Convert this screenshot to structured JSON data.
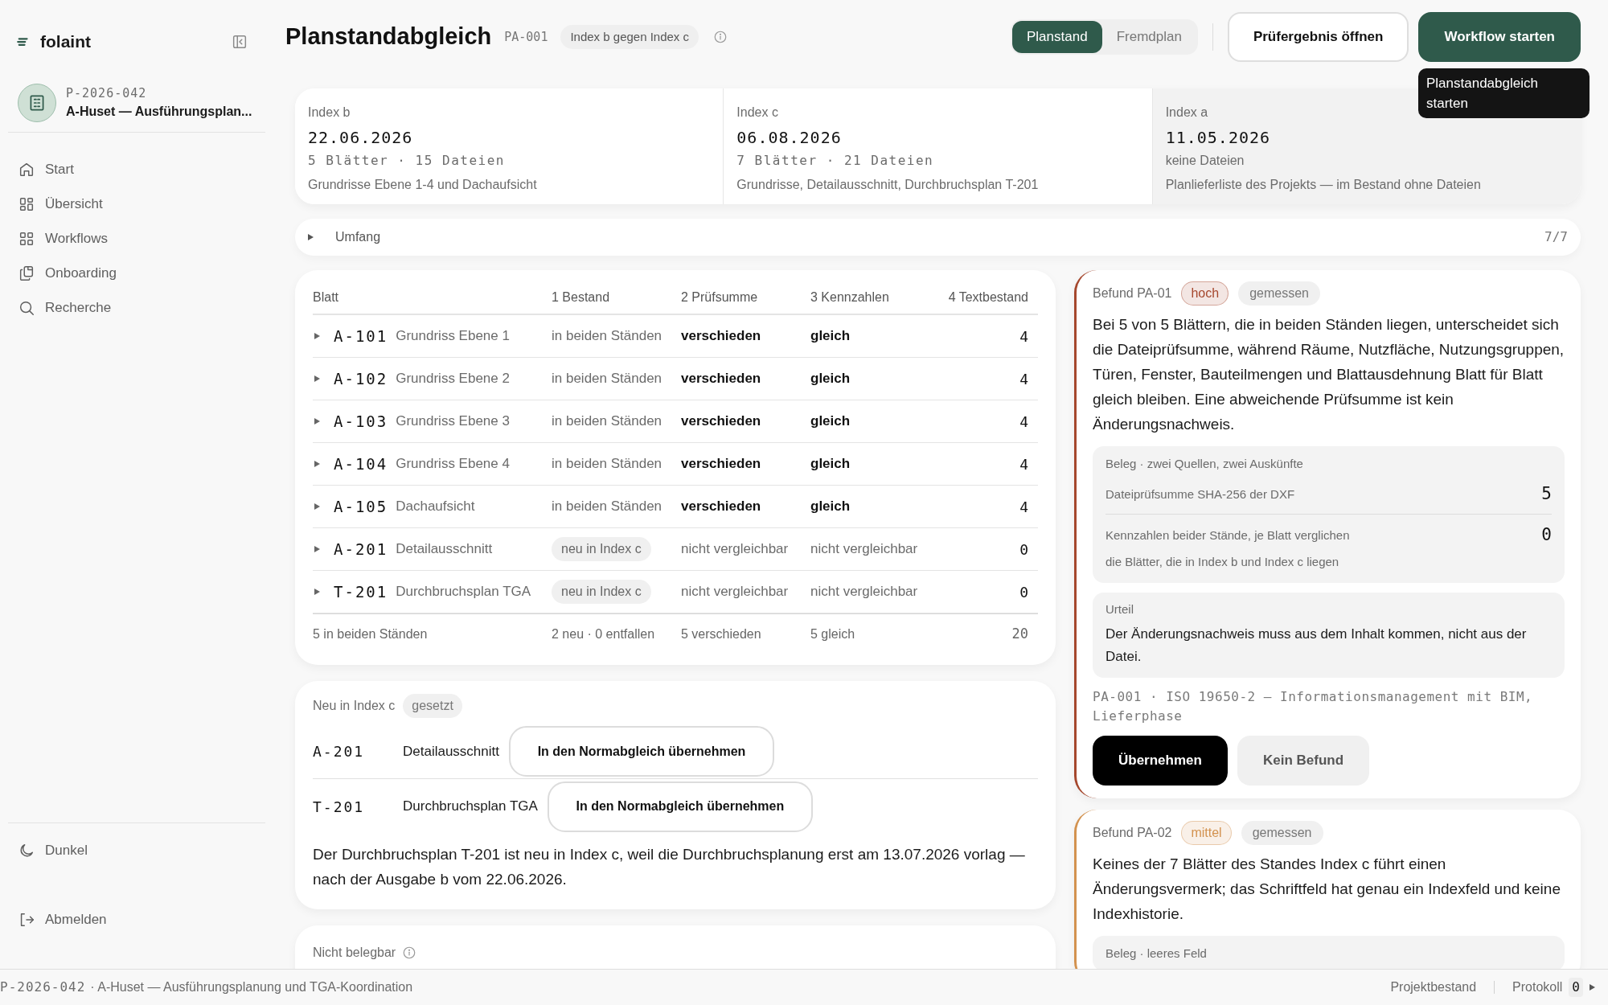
{
  "sidebar": {
    "logo": "folaint",
    "project": {
      "code": "P-2026-042",
      "name": "A-Huset — Ausführungsplan..."
    },
    "nav": [
      {
        "label": "Start"
      },
      {
        "label": "Übersicht"
      },
      {
        "label": "Workflows"
      },
      {
        "label": "Onboarding"
      },
      {
        "label": "Recherche"
      }
    ],
    "footer": [
      {
        "label": "Dunkel"
      },
      {
        "label": "Abmelden"
      }
    ]
  },
  "header": {
    "title": "Planstandabgleich",
    "code": "PA-001",
    "badge": "Index b gegen Index c",
    "segments": [
      {
        "label": "Planstand",
        "selected": true
      },
      {
        "label": "Fremdplan",
        "selected": false
      }
    ],
    "buttons": [
      {
        "label": "Prüfergebnis öffnen",
        "kind": "outline"
      },
      {
        "label": "Workflow starten",
        "kind": "primary"
      }
    ],
    "tooltip": "Planstandabgleich starten"
  },
  "index_cards": [
    {
      "label": "Index b",
      "date": "22.06.2026",
      "count": "5 Blätter · 15 Dateien",
      "description": "Grundrisse Ebene 1-4 und Dachaufsicht",
      "muted": false
    },
    {
      "label": "Index c",
      "date": "06.08.2026",
      "count": "7 Blätter · 21 Dateien",
      "description": "Grundrisse, Detailausschnitt, Durchbruchsplan T-201",
      "muted": false
    },
    {
      "label": "Index a",
      "date": "11.05.2026",
      "count": "keine Dateien",
      "description": "Planlieferliste des Projekts — im Bestand ohne Dateien",
      "muted": true
    }
  ],
  "scope": {
    "label": "Umfang",
    "count": "7/7",
    "expanded": false
  },
  "table": {
    "columns": [
      "Blatt",
      "1 Bestand",
      "2 Prüfsumme",
      "3 Kennzahlen",
      "4 Textbestand"
    ],
    "rows": [
      {
        "code": "A-101",
        "name": "Grundriss Ebene 1",
        "bestand": "in beiden Ständen",
        "pruefsumme": "verschieden",
        "kennzahlen": "gleich",
        "textbestand": "4",
        "new": false,
        "expanded": false
      },
      {
        "code": "A-102",
        "name": "Grundriss Ebene 2",
        "bestand": "in beiden Ständen",
        "pruefsumme": "verschieden",
        "kennzahlen": "gleich",
        "textbestand": "4",
        "new": false,
        "expanded": false
      },
      {
        "code": "A-103",
        "name": "Grundriss Ebene 3",
        "bestand": "in beiden Ständen",
        "pruefsumme": "verschieden",
        "kennzahlen": "gleich",
        "textbestand": "4",
        "new": false,
        "expanded": false
      },
      {
        "code": "A-104",
        "name": "Grundriss Ebene 4",
        "bestand": "in beiden Ständen",
        "pruefsumme": "verschieden",
        "kennzahlen": "gleich",
        "textbestand": "4",
        "new": false,
        "expanded": false
      },
      {
        "code": "A-105",
        "name": "Dachaufsicht",
        "bestand": "in beiden Ständen",
        "pruefsumme": "verschieden",
        "kennzahlen": "gleich",
        "textbestand": "4",
        "new": false,
        "expanded": false
      },
      {
        "code": "A-201",
        "name": "Detailausschnitt",
        "bestand": "neu in Index c",
        "pruefsumme": "nicht vergleichbar",
        "kennzahlen": "nicht vergleichbar",
        "textbestand": "0",
        "new": true,
        "expanded": false
      },
      {
        "code": "T-201",
        "name": "Durchbruchsplan TGA",
        "bestand": "neu in Index c",
        "pruefsumme": "nicht vergleichbar",
        "kennzahlen": "nicht vergleichbar",
        "textbestand": "0",
        "new": true,
        "expanded": false
      }
    ],
    "footer": [
      "5 in beiden Ständen",
      "2 neu · 0 entfallen",
      "5 verschieden",
      "5 gleich",
      "20"
    ]
  },
  "new_sheets": {
    "title": "Neu in Index c",
    "tag": "gesetzt",
    "rows": [
      {
        "code": "A-201",
        "name": "Detailausschnitt",
        "action": "In den Normabgleich übernehmen"
      },
      {
        "code": "T-201",
        "name": "Durchbruchsplan TGA",
        "action": "In den Normabgleich übernehmen"
      }
    ],
    "note": "Der Durchbruchsplan T-201 ist neu in Index c, weil die Durchbruchsplanung erst am 13.07.2026 vorlag — nach der Ausgabe b vom 22.06.2026."
  },
  "unprovable": {
    "title": "Nicht belegbar"
  },
  "findings": [
    {
      "title": "Befund PA-01",
      "severity": "hoch",
      "color": "#a5472d",
      "tag": "gemessen",
      "text": "Bei 5 von 5 Blättern, die in beiden Ständen liegen, unterscheidet sich die Dateiprüfsumme, während Räume, Nutzfläche, Nutzungsgruppen, Türen, Fenster, Bauteilmengen und Blattausdehnung Blatt für Blatt gleich bleiben. Eine abweichende Prüfsumme ist kein Änderungsnachweis.",
      "evidence": {
        "title": "Beleg · zwei Quellen, zwei Auskünfte",
        "rows": [
          {
            "label": "Dateiprüfsumme SHA-256 der DXF",
            "value": "5"
          },
          {
            "label": "Kennzahlen beider Stände, je Blatt verglichen",
            "value": "0",
            "note": "die Blätter, die in Index b und Index c liegen"
          }
        ]
      },
      "verdict": {
        "title": "Urteil",
        "text": "Der Änderungsnachweis muss aus dem Inhalt kommen, nicht aus der Datei."
      },
      "reference": "PA-001 · ISO 19650-2 — Informationsmanagement mit BIM, Lieferphase",
      "actions": [
        {
          "label": "Übernehmen",
          "kind": "dark"
        },
        {
          "label": "Kein Befund",
          "kind": "muted"
        }
      ]
    },
    {
      "title": "Befund PA-02",
      "severity": "mittel",
      "color": "#d3924f",
      "tag": "gemessen",
      "text": "Keines der 7 Blätter des Standes Index c führt einen Änderungsvermerk; das Schriftfeld hat genau ein Indexfeld und keine Indexhistorie.",
      "evidence": {
        "title": "Beleg · leeres Feld"
      }
    }
  ],
  "status_bar": {
    "project_code": "P-2026-042",
    "project_name": "· A-Huset — Ausführungsplanung und TGA-Koordination",
    "links": [
      "Projektbestand",
      "Protokoll"
    ],
    "count": "0"
  }
}
